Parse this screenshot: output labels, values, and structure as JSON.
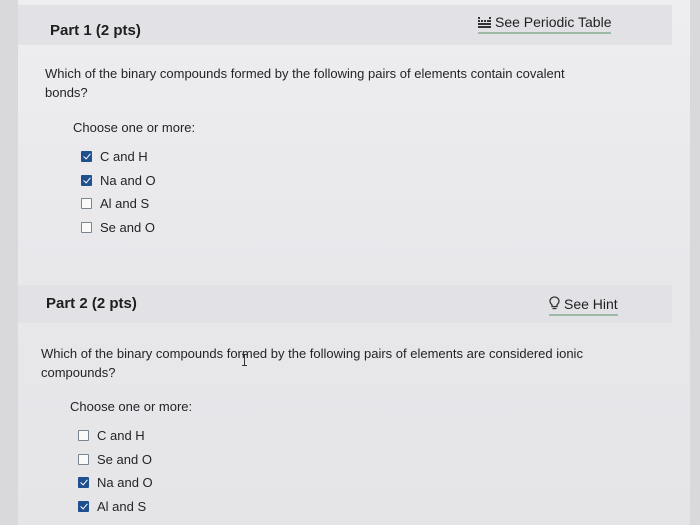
{
  "part1": {
    "title": "Part 1 (2 pts)",
    "link_label": "See Periodic Table",
    "link_icon": "periodic-table-icon",
    "question": "Which of the binary compounds formed by the following pairs of elements contain covalent bonds?",
    "choose_label": "Choose one or more:",
    "options": [
      {
        "label": "C and H",
        "checked": true
      },
      {
        "label": "Na and O",
        "checked": true
      },
      {
        "label": "Al and S",
        "checked": false
      },
      {
        "label": "Se and O",
        "checked": false
      }
    ]
  },
  "part2": {
    "title": "Part 2 (2 pts)",
    "link_label": "See Hint",
    "link_icon": "lightbulb-icon",
    "question": "Which of the binary compounds formed by the following pairs of elements are considered ionic compounds?",
    "choose_label": "Choose one or more:",
    "options": [
      {
        "label": "C and H",
        "checked": false
      },
      {
        "label": "Se and O",
        "checked": false
      },
      {
        "label": "Na and O",
        "checked": true
      },
      {
        "label": "Al and S",
        "checked": true
      }
    ]
  },
  "colors": {
    "checkbox_checked": "#1f4f8f",
    "link_underline": "#9fb9a8"
  }
}
